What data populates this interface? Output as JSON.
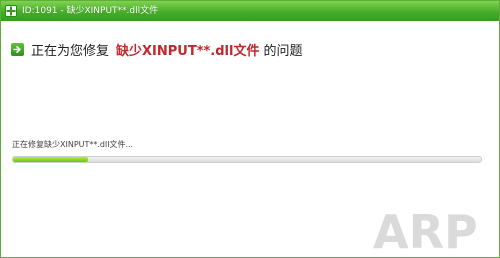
{
  "window": {
    "title": "ID:1091 - 缺少XINPUT**.dll文件"
  },
  "heading": {
    "prefix": "正在为您修复",
    "highlight": "缺少XINPUT**.dll文件",
    "suffix": "的问题"
  },
  "status": {
    "text": "正在修复缺少XINPUT**.dll文件..."
  },
  "progress": {
    "percent": 16
  },
  "colors": {
    "titlebar": "#46ad2a",
    "highlight": "#c0282d",
    "progress_fill": "#8ad334"
  },
  "icons": {
    "app": "app-logo-icon",
    "heading": "arrow-right-icon"
  }
}
